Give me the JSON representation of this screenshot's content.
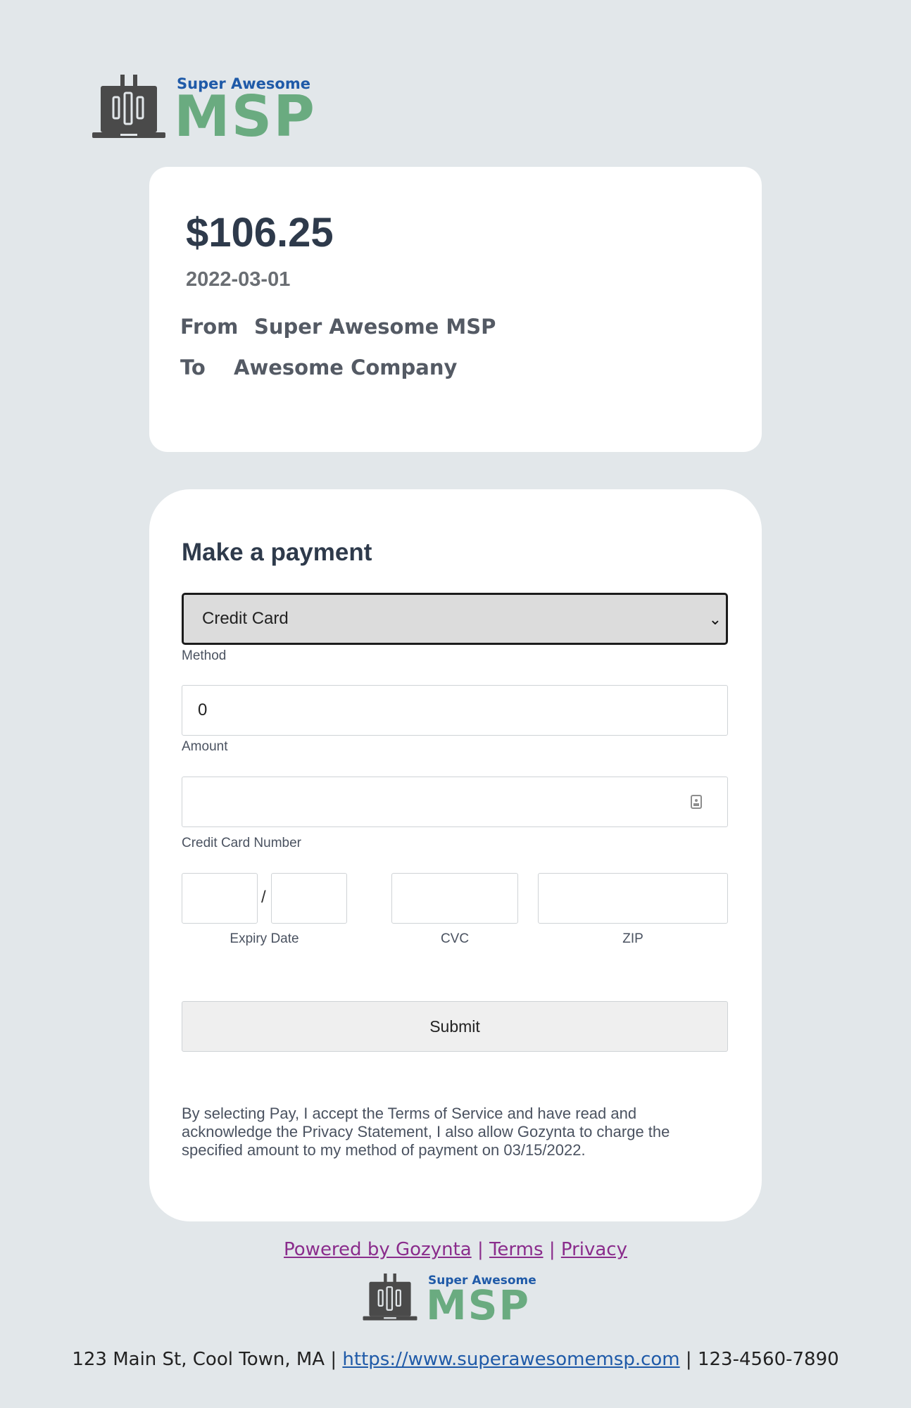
{
  "brand": {
    "line1": "Super Awesome",
    "line2": "MSP"
  },
  "summary": {
    "amount": "$106.25",
    "date": "2022-03-01",
    "from_label": "From",
    "from_value": "Super Awesome MSP",
    "to_label": "To",
    "to_value": "Awesome Company"
  },
  "payment": {
    "title": "Make a payment",
    "method_value": "Credit Card",
    "method_label": "Method",
    "amount_value": "0",
    "amount_label": "Amount",
    "card_number_label": "Credit Card Number",
    "expiry_label": "Expiry Date",
    "expiry_separator": "/",
    "cvc_label": "CVC",
    "zip_label": "ZIP",
    "submit_label": "Submit",
    "legal_text": "By selecting Pay, I accept the Terms of Service and have read and acknowledge the Privacy Statement, I also allow Gozynta to charge the specified amount to my method of payment on 03/15/2022."
  },
  "footer": {
    "powered_by": "Powered by Gozynta",
    "terms": "Terms",
    "privacy": "Privacy",
    "separator": "|",
    "address": "123 Main St, Cool Town, MA",
    "website": "https://www.superawesomemsp.com",
    "phone": "123-4560-7890"
  },
  "icons": {
    "logo": "laptop-tools-icon",
    "select": "chevron-down-icon",
    "card_autofill": "contact-card-icon"
  },
  "colors": {
    "background": "#e2e7ea",
    "brand_green": "#6aab80",
    "brand_blue": "#1f5aa8",
    "link_purple": "#8a2c8c",
    "heading": "#2e3a4b"
  }
}
